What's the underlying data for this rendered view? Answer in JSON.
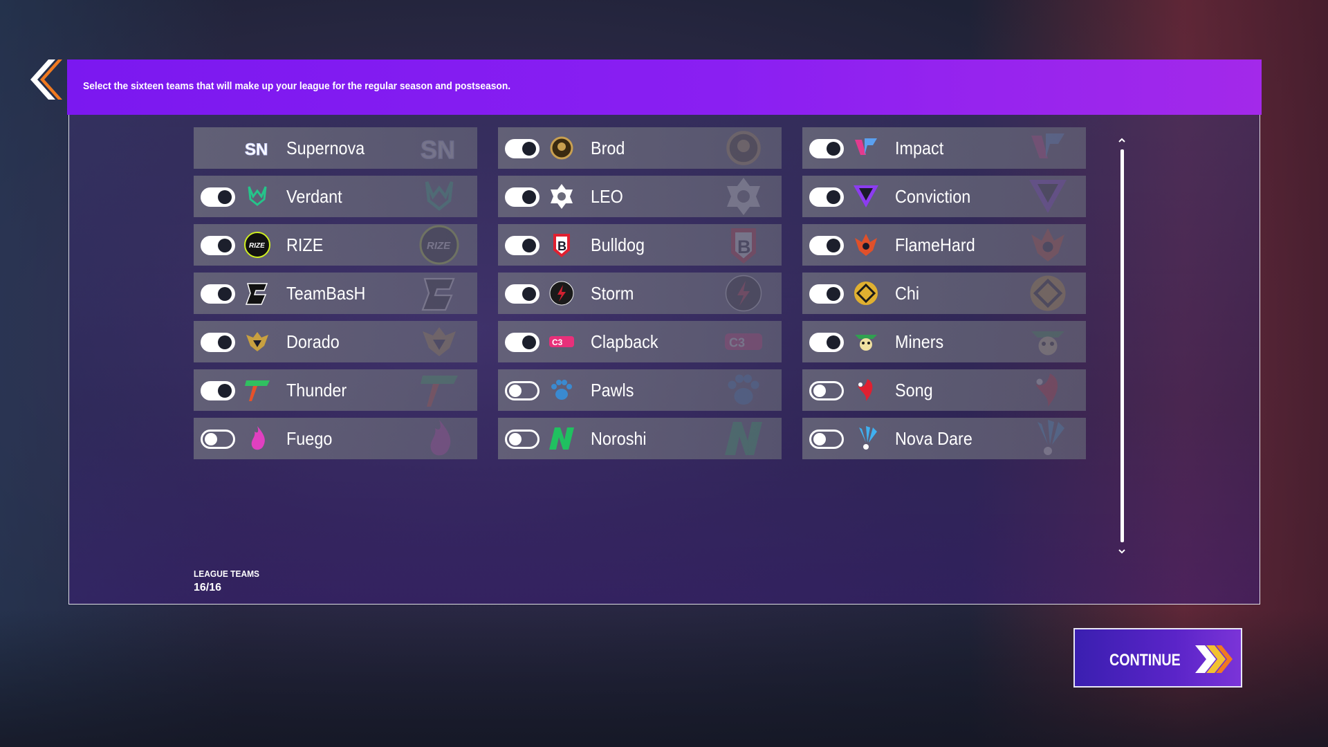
{
  "header": {
    "instruction": "Select the sixteen teams that will make up your league for the regular season and postseason."
  },
  "teams": [
    {
      "name": "Supernova",
      "enabled": null,
      "logo": "supernova-icon",
      "color": "#cfd4ff"
    },
    {
      "name": "Brod",
      "enabled": true,
      "logo": "brod-icon",
      "color": "#c9a050"
    },
    {
      "name": "Impact",
      "enabled": true,
      "logo": "impact-icon",
      "color": "#e23b8e"
    },
    {
      "name": "Verdant",
      "enabled": true,
      "logo": "verdant-icon",
      "color": "#25c48a"
    },
    {
      "name": "LEO",
      "enabled": true,
      "logo": "leo-icon",
      "color": "#ffffff"
    },
    {
      "name": "Conviction",
      "enabled": true,
      "logo": "conviction-icon",
      "color": "#8c3cf0"
    },
    {
      "name": "RIZE",
      "enabled": true,
      "logo": "rize-icon",
      "color": "#111111"
    },
    {
      "name": "Bulldog",
      "enabled": true,
      "logo": "bulldog-icon",
      "color": "#e02030"
    },
    {
      "name": "FlameHard",
      "enabled": true,
      "logo": "flamehard-icon",
      "color": "#e0502a"
    },
    {
      "name": "TeamBasH",
      "enabled": true,
      "logo": "teambash-icon",
      "color": "#111111"
    },
    {
      "name": "Storm",
      "enabled": true,
      "logo": "storm-icon",
      "color": "#d02030"
    },
    {
      "name": "Chi",
      "enabled": true,
      "logo": "chi-icon",
      "color": "#e0b030"
    },
    {
      "name": "Dorado",
      "enabled": true,
      "logo": "dorado-icon",
      "color": "#c8a040"
    },
    {
      "name": "Clapback",
      "enabled": true,
      "logo": "clapback-icon",
      "color": "#e8307a"
    },
    {
      "name": "Miners",
      "enabled": true,
      "logo": "miners-icon",
      "color": "#30a050"
    },
    {
      "name": "Thunder",
      "enabled": true,
      "logo": "thunder-icon",
      "color": "#e8502a"
    },
    {
      "name": "Pawls",
      "enabled": false,
      "logo": "pawls-icon",
      "color": "#3a8ad0"
    },
    {
      "name": "Song",
      "enabled": false,
      "logo": "song-icon",
      "color": "#e02030"
    },
    {
      "name": "Fuego",
      "enabled": false,
      "logo": "fuego-icon",
      "color": "#e040c0"
    },
    {
      "name": "Noroshi",
      "enabled": false,
      "logo": "noroshi-icon",
      "color": "#20c060"
    },
    {
      "name": "Nova Dare",
      "enabled": false,
      "logo": "nova-dare-icon",
      "color": "#40b0f0"
    }
  ],
  "footer": {
    "count_label": "LEAGUE TEAMS",
    "count_value": "16/16"
  },
  "continue": {
    "label": "CONTINUE"
  },
  "colors": {
    "header_accent": "#8a1ff2",
    "continue_accent": "#5a24c8",
    "chevron_orange": "#f07a20",
    "chevron_yellow": "#f2c230"
  }
}
